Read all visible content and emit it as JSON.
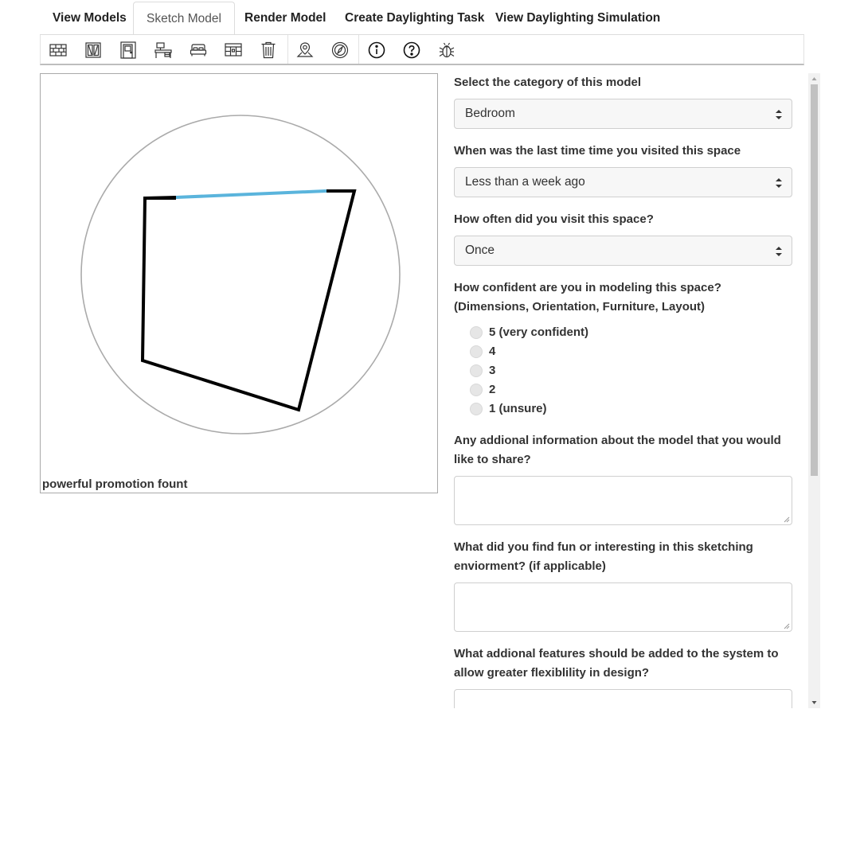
{
  "tabs": [
    {
      "label": "View Models",
      "active": false
    },
    {
      "label": "Sketch Model",
      "active": true
    },
    {
      "label": "Render Model",
      "active": false
    },
    {
      "label": "Create Daylighting Task",
      "active": false
    },
    {
      "label": "View Daylighting Simulation",
      "active": false
    }
  ],
  "toolbar": {
    "tools": [
      "wall-icon",
      "window-icon",
      "door-icon",
      "desk-icon",
      "bed-icon",
      "wardrobe-icon",
      "trash-icon",
      "location-pin-icon",
      "compass-icon",
      "info-icon",
      "help-icon",
      "bug-icon"
    ]
  },
  "canvas": {
    "label": "powerful promotion fount",
    "colors": {
      "wall": "#000000",
      "window": "#5ab4dc",
      "circle": "#aaaaaa"
    }
  },
  "form": {
    "category": {
      "question": "Select the category of this model",
      "value": "Bedroom"
    },
    "last_visit": {
      "question": "When was the last time time you visited this space",
      "value": "Less than a week ago"
    },
    "frequency": {
      "question": "How often did you visit this space?",
      "value": "Once"
    },
    "confidence": {
      "question": "How confident are you in modeling this space? (Dimensions, Orientation, Furniture, Layout)",
      "options": [
        "5 (very confident)",
        "4",
        "3",
        "2",
        "1 (unsure)"
      ]
    },
    "additional_info": {
      "question": "Any addional information about the model that you would like to share?",
      "value": ""
    },
    "fun": {
      "question": "What did you find fun or interesting in this sketching enviorment? (if applicable)",
      "value": ""
    },
    "features": {
      "question": "What addional features should be added to the system to allow greater flexiblility in design?",
      "value": ""
    }
  }
}
